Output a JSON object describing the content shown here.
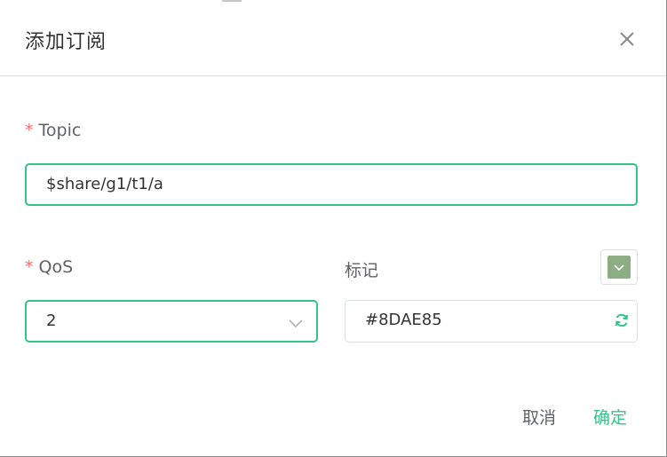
{
  "dialog": {
    "title": "添加订阅"
  },
  "form": {
    "topic": {
      "label": "Topic",
      "value": "$share/g1/t1/a"
    },
    "qos": {
      "label": "QoS",
      "value": "2"
    },
    "tag": {
      "label": "标记",
      "value": "#8DAE85",
      "color": "#8DAE85"
    },
    "required_mark": "*"
  },
  "footer": {
    "cancel_label": "取消",
    "confirm_label": "确定"
  },
  "colors": {
    "accent": "#34C388",
    "required": "#F56C6C"
  },
  "icons": {
    "close": "close-icon",
    "chevron": "chevron-down-icon",
    "refresh": "refresh-icon"
  }
}
